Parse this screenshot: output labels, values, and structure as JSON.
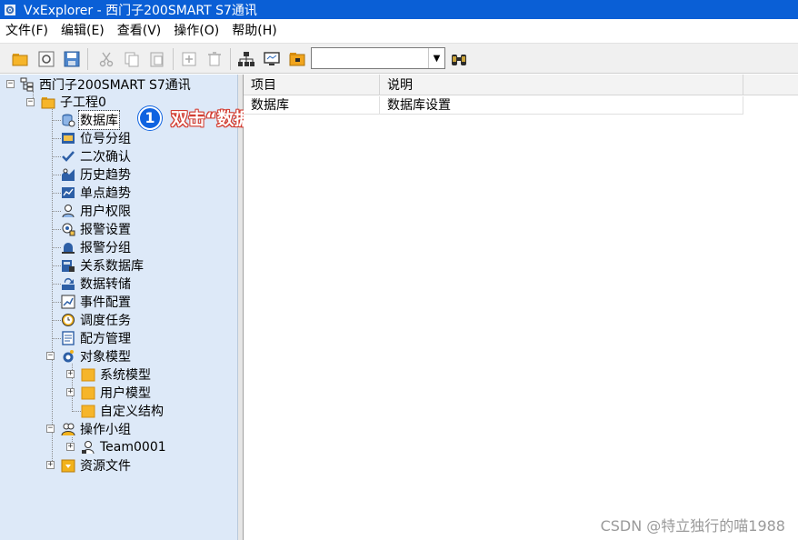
{
  "window": {
    "title": "VxExplorer - 西门子200SMART S7通讯",
    "icon": "gear-icon"
  },
  "menu": [
    {
      "label": "文件(F)"
    },
    {
      "label": "编辑(E)"
    },
    {
      "label": "查看(V)"
    },
    {
      "label": "操作(O)"
    },
    {
      "label": "帮助(H)"
    }
  ],
  "toolbar": {
    "buttons": [
      "open-folder-icon",
      "refresh-icon",
      "save-icon",
      "cut-icon",
      "copy-icon",
      "paste-icon",
      "add-icon",
      "delete-icon",
      "network-icon",
      "monitor-icon",
      "project-icon",
      "find-icon"
    ],
    "combo_value": ""
  },
  "tree": {
    "root": "西门子200SMART S7通讯",
    "project": "子工程0",
    "items": [
      {
        "label": "数据库",
        "icon": "database-icon",
        "selected": true
      },
      {
        "label": "位号分组",
        "icon": "tag-group-icon"
      },
      {
        "label": "二次确认",
        "icon": "check-icon"
      },
      {
        "label": "历史趋势",
        "icon": "history-trend-icon"
      },
      {
        "label": "单点趋势",
        "icon": "single-trend-icon"
      },
      {
        "label": "用户权限",
        "icon": "user-icon"
      },
      {
        "label": "报警设置",
        "icon": "alarm-settings-icon"
      },
      {
        "label": "报警分组",
        "icon": "alarm-group-icon"
      },
      {
        "label": "关系数据库",
        "icon": "relational-db-icon"
      },
      {
        "label": "数据转储",
        "icon": "data-dump-icon"
      },
      {
        "label": "事件配置",
        "icon": "event-config-icon"
      },
      {
        "label": "调度任务",
        "icon": "clock-icon"
      },
      {
        "label": "配方管理",
        "icon": "recipe-icon"
      },
      {
        "label": "对象模型",
        "icon": "object-model-icon"
      }
    ],
    "object_model_children": [
      "系统模型",
      "用户模型",
      "自定义结构"
    ],
    "operation_group": "操作小组",
    "team": "Team0001",
    "resources": "资源文件"
  },
  "list": {
    "columns": [
      "项目",
      "说明"
    ],
    "rows": [
      {
        "item": "数据库",
        "desc": "数据库设置"
      }
    ]
  },
  "annotation": {
    "number": "1",
    "text": "双击“数据库”"
  },
  "watermark": "CSDN @特立独行的喵1988",
  "colors": {
    "titlebar": "#0a5fd6",
    "tree_background": "#dde9f8",
    "annotation_accent": "#0f63e0",
    "annotation_outline": "#d23a2e"
  }
}
